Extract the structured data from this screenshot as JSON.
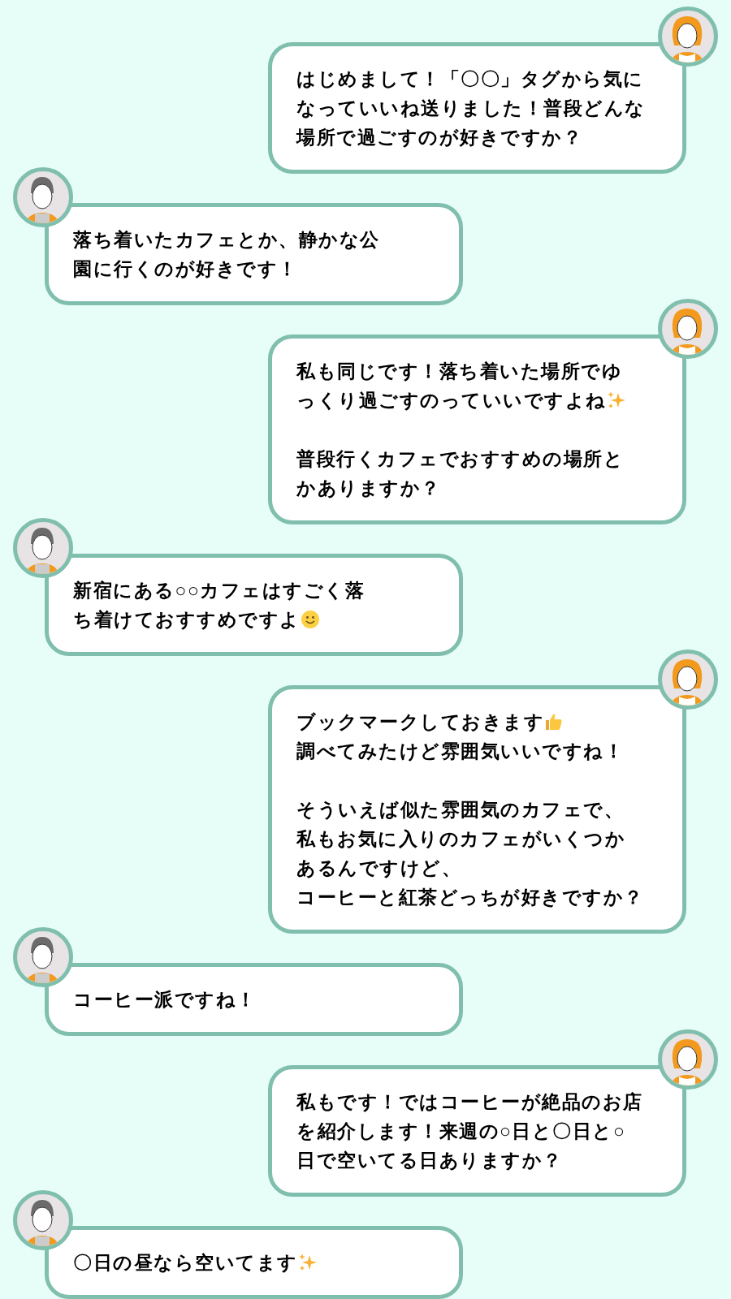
{
  "messages": [
    {
      "kind": "sent",
      "paragraphs": [
        [
          {
            "kind": "plain",
            "text": "はじめまして！「〇〇」タグから気に"
          },
          {
            "kind": "plain",
            "text": "なっていいね送りました！普段どんな"
          },
          {
            "kind": "plain",
            "text": "場所で過ごすのが好きですか？"
          }
        ]
      ]
    },
    {
      "kind": "received",
      "paragraphs": [
        [
          {
            "kind": "plain",
            "text": "落ち着いたカフェとか、静かな公"
          },
          {
            "kind": "plain",
            "text": "園に行くのが好きです！"
          }
        ]
      ]
    },
    {
      "kind": "sent",
      "paragraphs": [
        [
          {
            "kind": "plain",
            "text": "私も同じです！落ち着いた場所でゆ"
          },
          {
            "kind": "sparkles",
            "text": "っくり過ごすのっていいですよね"
          }
        ],
        [
          {
            "kind": "plain",
            "text": "普段行くカフェでおすすめの場所と"
          },
          {
            "kind": "plain",
            "text": "かありますか？"
          }
        ]
      ]
    },
    {
      "kind": "received",
      "paragraphs": [
        [
          {
            "kind": "plain",
            "text": "新宿にある○○カフェはすごく落"
          },
          {
            "kind": "smile",
            "text": "ち着けておすすめですよ"
          }
        ]
      ]
    },
    {
      "kind": "sent",
      "paragraphs": [
        [
          {
            "kind": "thumbs-up",
            "text": "ブックマークしておきます"
          },
          {
            "kind": "plain",
            "text": "調べてみたけど雰囲気いいですね！"
          }
        ],
        [
          {
            "kind": "plain",
            "text": "そういえば似た雰囲気のカフェで、"
          },
          {
            "kind": "plain",
            "text": "私もお気に入りのカフェがいくつか"
          },
          {
            "kind": "plain",
            "text": "あるんですけど、"
          },
          {
            "kind": "plain",
            "text": "コーヒーと紅茶どっちが好きですか？"
          }
        ]
      ]
    },
    {
      "kind": "received",
      "paragraphs": [
        [
          {
            "kind": "plain",
            "text": "コーヒー派ですね！"
          }
        ]
      ]
    },
    {
      "kind": "sent",
      "paragraphs": [
        [
          {
            "kind": "plain",
            "text": "私もです！ではコーヒーが絶品のお店"
          },
          {
            "kind": "plain",
            "text": "を紹介します！来週の○日と〇日と○"
          },
          {
            "kind": "plain",
            "text": "日で空いてる日ありますか？"
          }
        ]
      ]
    },
    {
      "kind": "received",
      "paragraphs": [
        [
          {
            "kind": "sparkles",
            "text": "〇日の昼なら空いてます"
          }
        ]
      ]
    }
  ]
}
